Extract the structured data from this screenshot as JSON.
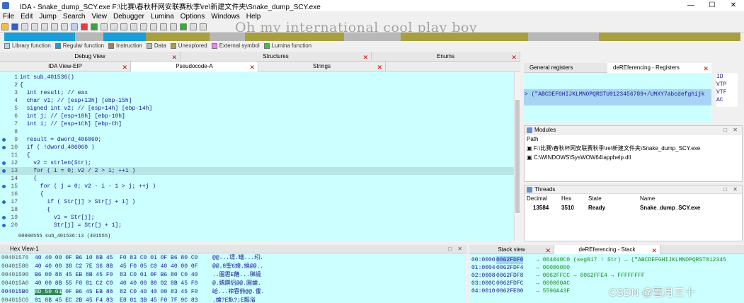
{
  "titlebar": {
    "title": "IDA - Snake_dump_SCY.exe F:\\比赛\\春秋杯网安联赛秋季\\re\\新建文件夹\\Snake_dump_SCY.exe",
    "minimize": "—",
    "maximize": "☐",
    "close": "✕"
  },
  "menu": [
    "File",
    "Edit",
    "Jump",
    "Search",
    "View",
    "Debugger",
    "Lumina",
    "Options",
    "Windows",
    "Help"
  ],
  "overlay_text": "Oh my international cool play boy",
  "legend": [
    {
      "label": "Library function",
      "color": "#a8d8ea"
    },
    {
      "label": "Regular function",
      "color": "#1a9fd8"
    },
    {
      "label": "Instruction",
      "color": "#b07a5a"
    },
    {
      "label": "Data",
      "color": "#b8b8b8"
    },
    {
      "label": "Unexplored",
      "color": "#a8a040"
    },
    {
      "label": "External symbol",
      "color": "#f080f0"
    },
    {
      "label": "Lumina function",
      "color": "#40c040"
    }
  ],
  "tabs_row1": [
    "Debug View",
    "Structures",
    "Enums"
  ],
  "tabs_row2": [
    "IDA View-EIP",
    "Pseudocode-A",
    "Strings"
  ],
  "pseudocode": [
    {
      "n": "1",
      "dot": false,
      "text": "int sub_401536()",
      "hl": false
    },
    {
      "n": "2",
      "dot": false,
      "text": "{",
      "hl": false
    },
    {
      "n": "3",
      "dot": false,
      "text": "  int result; // eax",
      "hl": false
    },
    {
      "n": "4",
      "dot": false,
      "text": "  char v1; // [esp+13h] [ebp-15h]",
      "hl": false
    },
    {
      "n": "5",
      "dot": false,
      "text": "  signed int v2; // [esp+14h] [ebp-14h]",
      "hl": false
    },
    {
      "n": "6",
      "dot": false,
      "text": "  int j; // [esp+18h] [ebp-10h]",
      "hl": false
    },
    {
      "n": "7",
      "dot": false,
      "text": "  int i; // [esp+1Ch] [ebp-Ch]",
      "hl": false
    },
    {
      "n": "8",
      "dot": false,
      "text": "",
      "hl": false
    },
    {
      "n": "9",
      "dot": true,
      "text": "  result = dword_406060;",
      "hl": false
    },
    {
      "n": "10",
      "dot": true,
      "text": "  if ( !dword_406060 )",
      "hl": false
    },
    {
      "n": "11",
      "dot": false,
      "text": "  {",
      "hl": false
    },
    {
      "n": "12",
      "dot": true,
      "text": "    v2 = strlen(Str);",
      "hl": false
    },
    {
      "n": "13",
      "dot": true,
      "text": "    for ( i = 0; v2 / 2 > i; ++i )",
      "hl": true
    },
    {
      "n": "14",
      "dot": false,
      "text": "    {",
      "hl": false
    },
    {
      "n": "15",
      "dot": true,
      "text": "      for ( j = 0; v2 - i - 1 > j; ++j )",
      "hl": false
    },
    {
      "n": "16",
      "dot": false,
      "text": "      {",
      "hl": false
    },
    {
      "n": "17",
      "dot": true,
      "text": "        if ( Str[j] > Str[j + 1] )",
      "hl": false
    },
    {
      "n": "18",
      "dot": false,
      "text": "        {",
      "hl": false
    },
    {
      "n": "19",
      "dot": true,
      "text": "          v1 = Str[j];",
      "hl": false
    },
    {
      "n": "20",
      "dot": true,
      "text": "          Str[j] = Str[j + 1];",
      "hl": false
    }
  ],
  "pseudo_status": "00000555 sub_401536:13 (401555)",
  "right_tabs": [
    "General registers",
    "deREferencing - Registers"
  ],
  "reg_value": "> (\"ABCDEFGHIJKLMNOPQRSTU0123456789+/UMXY7abcdefghijk",
  "reg_side": [
    "ID",
    "VTP",
    "VTF",
    "AC"
  ],
  "modules": {
    "title": "Modules",
    "header": "Path",
    "rows": [
      "F:\\比赛\\春秋杯网安联赛秋季\\re\\新建文件夹\\Snake_dump_SCY.exe",
      "C:\\WINDOWS\\SysWOW64\\apphelp.dll"
    ]
  },
  "threads": {
    "title": "Threads",
    "headers": [
      "Decimal",
      "Hex",
      "State",
      "Name"
    ],
    "rows": [
      [
        "13584",
        "3510",
        "Ready",
        "Snake_dump_SCY.exe"
      ]
    ]
  },
  "hex": {
    "title": "Hex View-1",
    "rows": [
      {
        "addr": "00401570",
        "bytes": "40 40 00 0F B6 10 8B 45  F0 83 C0 01 0F B6 80 C0",
        "ascii": "@@...埥.罎...纼."
      },
      {
        "addr": "00401580",
        "bytes": "40 40 00 38 C2 7E 36 8B  45 F0 05 C0 40 40 00 0F",
        "ascii": "@@.8聖6媴.繞@@.."
      },
      {
        "addr": "00401590",
        "bytes": "B6 00 88 45 EB 8B 45 F0  83 C0 01 0F B6 80 C0 40",
        "ascii": "..圗雼E饍...稊繞"
      },
      {
        "addr": "004015A0",
        "bytes": "40 00 8B 55 F0 81 C2 C0  40 40 00 88 02 8B 45 F0",
        "ascii": "@.媀饌侣@@.圓婨."
      },
      {
        "addr": "004015B0",
        "bytes": "8D 50 01 0F B6 45 EB 88  82 C0 40 40 00 83 45 F0",
        "ascii": "峆...禘雸偫@@.僂."
      },
      {
        "addr": "004015C0",
        "bytes": "01 8B 45 EC 2B 45 F4 83  E8 01 3B 45 F0 7F 9C 83",
        "ascii": ".婨?E魞?;E饇渻"
      }
    ]
  },
  "stack_tabs": [
    "Stack view",
    "deREferencing - Stack"
  ],
  "stack": [
    {
      "idx": "00:0000",
      "addr": "0062FDF0",
      "text": "→ 004040C0 (seg017 ! Str) → (\"ABCDEFGHIJKLMNOPQRST012345"
    },
    {
      "idx": "01:0004",
      "addr": "0062FDF4",
      "text": "→ 00000000"
    },
    {
      "idx": "02:0008",
      "addr": "0062FDF8",
      "text": "→ 0062FFCC → 0062FFE4 → FFFFFFFF"
    },
    {
      "idx": "03:000C",
      "addr": "0062FDFC",
      "text": "→ 000000AC"
    },
    {
      "idx": "04:0010",
      "addr": "0062FE00",
      "text": "→ 5596A43F"
    }
  ],
  "watermark": "CSDN @雪月三十"
}
